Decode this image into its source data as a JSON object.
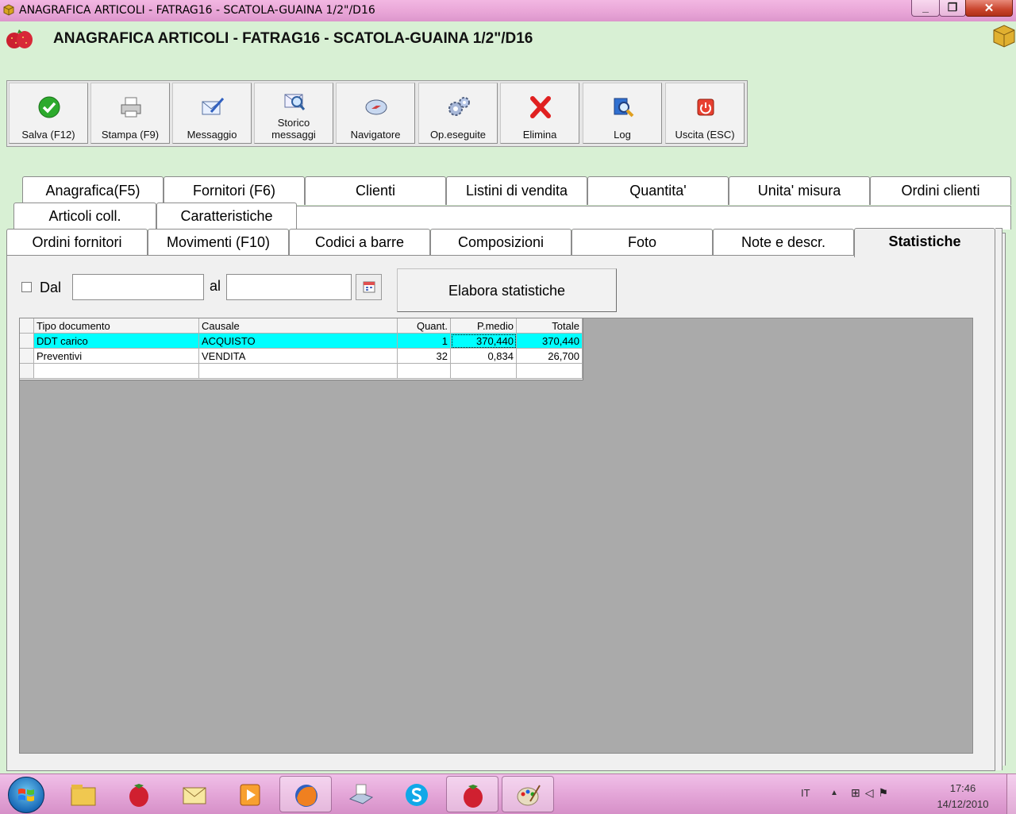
{
  "window": {
    "title": "ANAGRAFICA ARTICOLI - FATRAG16 - SCATOLA-GUAINA 1/2\"/D16",
    "min_label": "_",
    "max_label": "❐",
    "close_label": "✕"
  },
  "header": {
    "title": "ANAGRAFICA ARTICOLI - FATRAG16 - SCATOLA-GUAINA 1/2\"/D16"
  },
  "toolbar": {
    "buttons": [
      {
        "label": "Salva (F12)",
        "icon": "check-icon"
      },
      {
        "label": "Stampa (F9)",
        "icon": "printer-icon"
      },
      {
        "label": "Messaggio",
        "icon": "message-icon"
      },
      {
        "label": "Storico messaggi",
        "icon": "message-history-icon"
      },
      {
        "label": "Navigatore",
        "icon": "compass-icon"
      },
      {
        "label": "Op.eseguite",
        "icon": "gears-icon"
      },
      {
        "label": "Elimina",
        "icon": "delete-x-icon"
      },
      {
        "label": "Log",
        "icon": "log-magnifier-icon"
      },
      {
        "label": "Uscita (ESC)",
        "icon": "power-icon"
      }
    ]
  },
  "tabs": {
    "row1": [
      "Anagrafica(F5)",
      "Fornitori (F6)",
      "Clienti",
      "Listini di vendita",
      "Quantita'",
      "Unita' misura",
      "Ordini clienti"
    ],
    "row2": [
      "Articoli coll.",
      "Caratteristiche"
    ],
    "row3": [
      "Ordini fornitori",
      "Movimenti (F10)",
      "Codici a barre",
      "Composizioni",
      "Foto",
      "Note e descr.",
      "Statistiche"
    ],
    "active": "Statistiche"
  },
  "filter": {
    "dal_label": "Dal",
    "dal_checked": false,
    "dal_value": "",
    "al_label": "al",
    "al_value": "",
    "calendar_icon": "calendar-icon",
    "elabora_label": "Elabora statistiche"
  },
  "grid": {
    "headers": [
      "Tipo documento",
      "Causale",
      "Quant.",
      "P.medio",
      "Totale"
    ],
    "rows": [
      {
        "tipo": "DDT carico",
        "causale": "ACQUISTO",
        "quant": "1",
        "pmedio": "370,440",
        "totale": "370,440",
        "selected": true
      },
      {
        "tipo": "Preventivi",
        "causale": "VENDITA",
        "quant": "32",
        "pmedio": "0,834",
        "totale": "26,700",
        "selected": false
      }
    ]
  },
  "taskbar": {
    "apps": [
      "explorer-icon",
      "strawberry-app-icon",
      "mail-icon",
      "media-player-icon",
      "firefox-icon",
      "scanner-icon",
      "skype-icon",
      "strawberry-app-icon",
      "paint-icon"
    ],
    "lang": "IT",
    "time": "17:46",
    "date": "14/12/2010"
  },
  "colors": {
    "selection": "#00ffff",
    "background": "#d8f0d4",
    "titlebar": "#e8a4d6"
  }
}
